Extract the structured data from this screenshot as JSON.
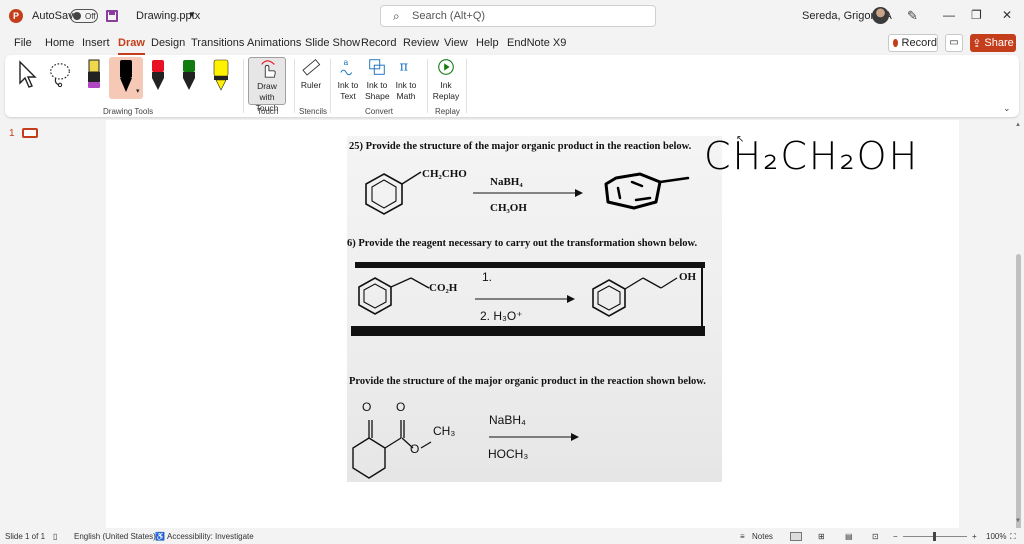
{
  "titlebar": {
    "app_logo": "P",
    "autosave_label": "AutoSave",
    "autosave_state": "Off",
    "file_name": "Drawing.pptx",
    "search_placeholder": "Search (Alt+Q)",
    "user_name": "Sereda, Grigoriy A",
    "min_glyph": "—",
    "restore_glyph": "❐",
    "close_glyph": "✕"
  },
  "menu": [
    "File",
    "Home",
    "Insert",
    "Draw",
    "Design",
    "Transitions",
    "Animations",
    "Slide Show",
    "Record",
    "Review",
    "View",
    "Help",
    "EndNote X9"
  ],
  "menu_active": "Draw",
  "actions": {
    "record": "Record",
    "share": "Share"
  },
  "ribbon": {
    "groups": {
      "drawing_tools": "Drawing Tools",
      "touch": "Touch",
      "stencils": "Stencils",
      "convert": "Convert",
      "replay": "Replay"
    },
    "draw_with_touch": "Draw with Touch",
    "ruler": "Ruler",
    "ink_to_text": "Ink to Text",
    "ink_to_shape": "Ink to Shape",
    "ink_to_math": "Ink to Math",
    "ink_replay": "Ink Replay",
    "pen_colors": [
      "#000000",
      "#e81123",
      "#107c10",
      "#fff100"
    ],
    "highlighter_color": "#b146c2"
  },
  "slides": {
    "current": "1"
  },
  "content": {
    "q25": "25) Provide the structure of the major organic product in the reaction below.",
    "q25_substituent": "CH₂CHO",
    "q25_reagent": "NaBH₄",
    "q25_solvent": "CH₃OH",
    "q26": "6) Provide the reagent necessary to carry out the transformation shown below.",
    "q26_substituent": "CO₂H",
    "q26_step1": "1.",
    "q26_step2": "2. H₃O⁺",
    "q26_product_group": "OH",
    "q27": "Provide the structure of the major organic product in the reaction shown below.",
    "q27_o1": "O",
    "q27_o2": "O",
    "q27_ester": "O",
    "q27_methyl": "CH₃",
    "q27_reagent": "NaBH₄",
    "q27_solvent": "HOCH₃",
    "handwriting": "CH₂CH₂OH"
  },
  "status": {
    "slide_info": "Slide 1 of 1",
    "language": "English (United States)",
    "accessibility": "Accessibility: Investigate",
    "notes": "Notes",
    "zoom": "100%",
    "zoom_minus": "−",
    "zoom_plus": "+"
  },
  "colors": {
    "accent": "#c43e1c"
  }
}
